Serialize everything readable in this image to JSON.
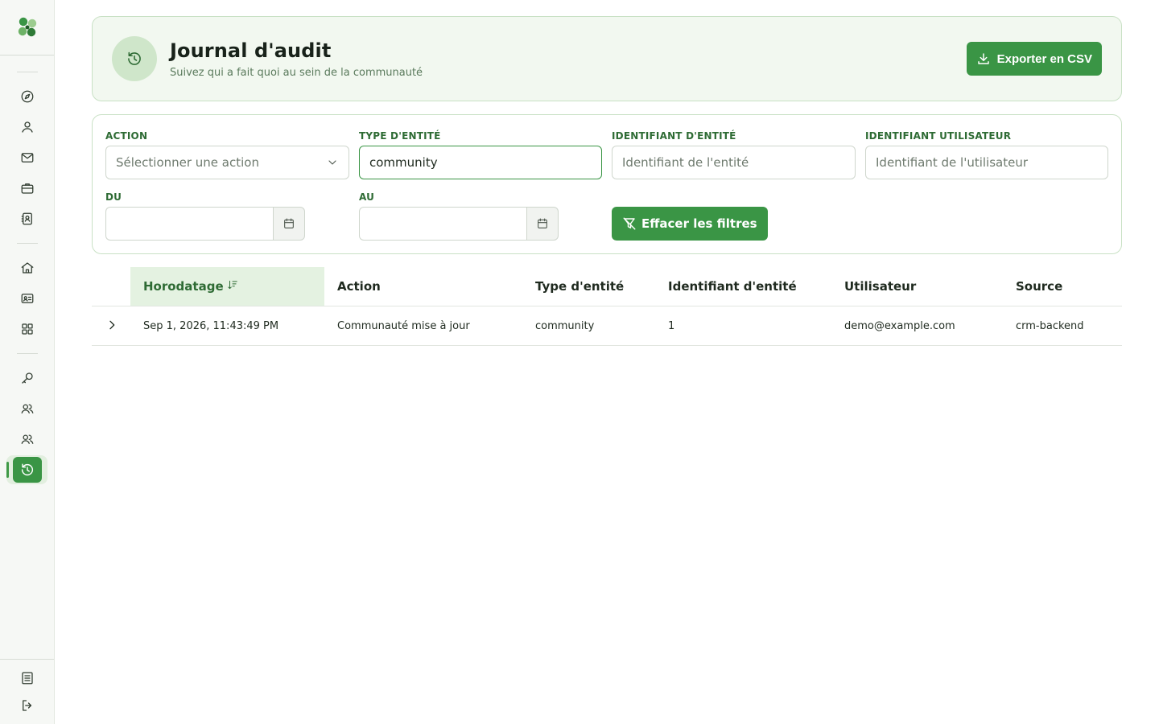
{
  "sidebar": {
    "logo": "clover-logo",
    "nav": [
      {
        "icon": "compass-icon",
        "name": "nav-explore"
      },
      {
        "icon": "user-icon",
        "name": "nav-contacts"
      },
      {
        "icon": "mail-icon",
        "name": "nav-messages"
      },
      {
        "icon": "briefcase-icon",
        "name": "nav-deals"
      },
      {
        "icon": "contact-book-icon",
        "name": "nav-address-book"
      },
      {
        "icon": "home-icon",
        "name": "nav-home"
      },
      {
        "icon": "id-card-icon",
        "name": "nav-members"
      },
      {
        "icon": "grid-icon",
        "name": "nav-apps"
      },
      {
        "icon": "key-icon",
        "name": "nav-keys"
      },
      {
        "icon": "users-icon",
        "name": "nav-users"
      },
      {
        "icon": "users-icon",
        "name": "nav-groups"
      },
      {
        "icon": "history-icon",
        "name": "nav-audit-log",
        "active": true
      }
    ],
    "bottom": [
      {
        "icon": "document-icon",
        "name": "nav-docs"
      },
      {
        "icon": "logout-icon",
        "name": "nav-logout"
      }
    ]
  },
  "header": {
    "title": "Journal d'audit",
    "subtitle": "Suivez qui a fait quoi au sein de la communauté",
    "export_label": "Exporter en CSV"
  },
  "filters": {
    "action_label": "ACTION",
    "action_placeholder": "Sélectionner une action",
    "entity_type_label": "TYPE D'ENTITÉ",
    "entity_type_value": "community",
    "entity_id_label": "IDENTIFIANT D'ENTITÉ",
    "entity_id_placeholder": "Identifiant de l'entité",
    "user_id_label": "IDENTIFIANT UTILISATEUR",
    "user_id_placeholder": "Identifiant de l'utilisateur",
    "from_label": "DU",
    "to_label": "AU",
    "clear_label": "Effacer les filtres"
  },
  "table": {
    "columns": [
      "Horodatage",
      "Action",
      "Type d'entité",
      "Identifiant d'entité",
      "Utilisateur",
      "Source"
    ],
    "sorted_column": "Horodatage",
    "rows": [
      {
        "timestamp": "Sep 1, 2026, 11:43:49 PM",
        "action": "Communauté mise à jour",
        "entity_type": "community",
        "entity_id": "1",
        "user": "demo@example.com",
        "source": "crm-backend"
      }
    ]
  },
  "colors": {
    "accent": "#3a9545",
    "accent_light": "#e4f2e1",
    "header_bg": "#f2f8f0"
  }
}
